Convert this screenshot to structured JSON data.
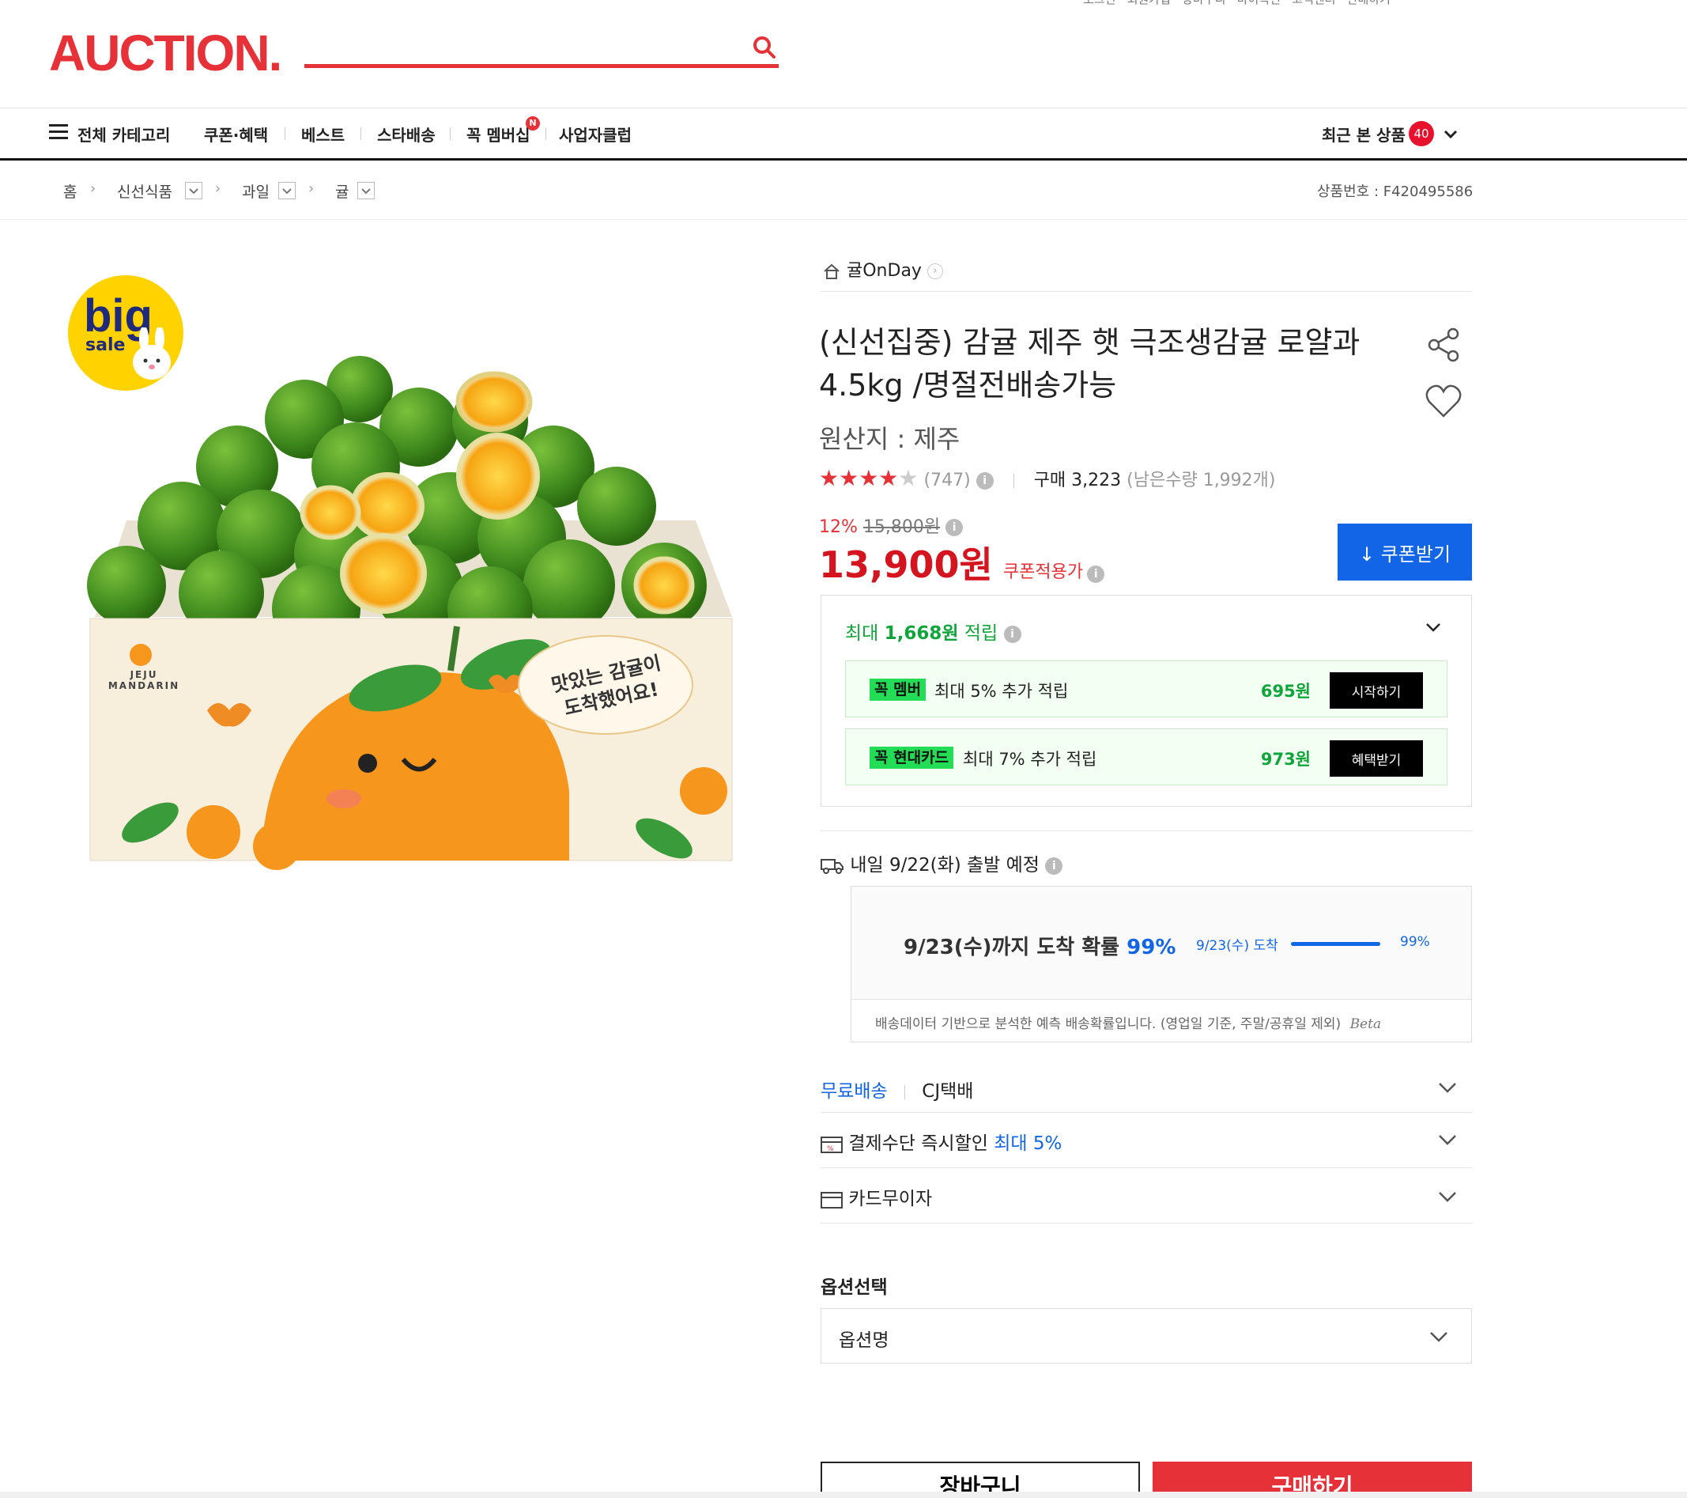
{
  "header": {
    "top_links": "로그인 · 회원가입 · 장바구니 · 마이옥션 · 고객센터 · 판매하기",
    "logo": "AUCTION.",
    "search_placeholder": ""
  },
  "nav": {
    "all_categories": "전체 카테고리",
    "items": [
      "쿠폰·혜택",
      "베스트",
      "스타배송",
      "꼭 멤버십",
      "사업자클럽"
    ],
    "new_badge": "N",
    "recent_label": "최근 본 상품",
    "recent_count": "40"
  },
  "breadcrumb": {
    "items": [
      "홈",
      "신선식품",
      "과일",
      "귤"
    ],
    "product_no": "상품번호 : F420495586"
  },
  "image": {
    "big_sale_line1": "big",
    "big_sale_line2": "sale",
    "box_brand": "JEJU MANDARIN",
    "box_speech": "맛있는 감귤이 도착했어요!"
  },
  "product": {
    "store": "귤OnDay",
    "title": "(신선집중) 감귤 제주 햇 극조생감귤 로얄과 4.5kg /명절전배송가능",
    "origin": "원산지 : 제주",
    "rating_value": 4,
    "review_count": "(747)",
    "purchase": "구매 3,223",
    "stock": "(남은수량 1,992개)",
    "discount_rate": "12%",
    "original_price": "15,800원",
    "price": "13,900원",
    "price_note": "쿠폰적용가",
    "coupon_button": "쿠폰받기"
  },
  "reward": {
    "title_prefix": "최대 ",
    "title_amount": "1,668원",
    "title_suffix": " 적립",
    "rows": [
      {
        "tag": "꼭 멤버",
        "text": "최대 5% 추가 적립",
        "amount": "695원",
        "button": "시작하기"
      },
      {
        "tag": "꼭 현대카드",
        "text": "최대 7% 추가 적립",
        "amount": "973원",
        "button": "혜택받기"
      }
    ]
  },
  "delivery": {
    "ship_text": "내일 9/22(화) 출발 예정",
    "main_prefix": "9/23(수)까지 도착 확률 ",
    "main_pct": "99%",
    "bar_label": "9/23(수) 도착",
    "bar_pct": "99%",
    "bar_fraction": 0.99,
    "note": "배송데이터 기반으로 분석한 예측 배송확률입니다. (영업일 기준, 주말/공휴일 제외)",
    "beta": "Beta"
  },
  "rows": {
    "free_shipping": "무료배송",
    "courier": "CJ택배",
    "payment_label": "결제수단 즉시할인 ",
    "payment_max": "최대 5%",
    "card": "카드무이자"
  },
  "options": {
    "label": "옵션선택",
    "placeholder": "옵션명"
  },
  "buttons": {
    "cart": "장바구니",
    "buy": "구매하기"
  },
  "colors": {
    "brand_red": "#e53137",
    "price_red": "#d4141f",
    "coupon_blue": "#1165e6",
    "reward_green": "#0fa53a"
  }
}
